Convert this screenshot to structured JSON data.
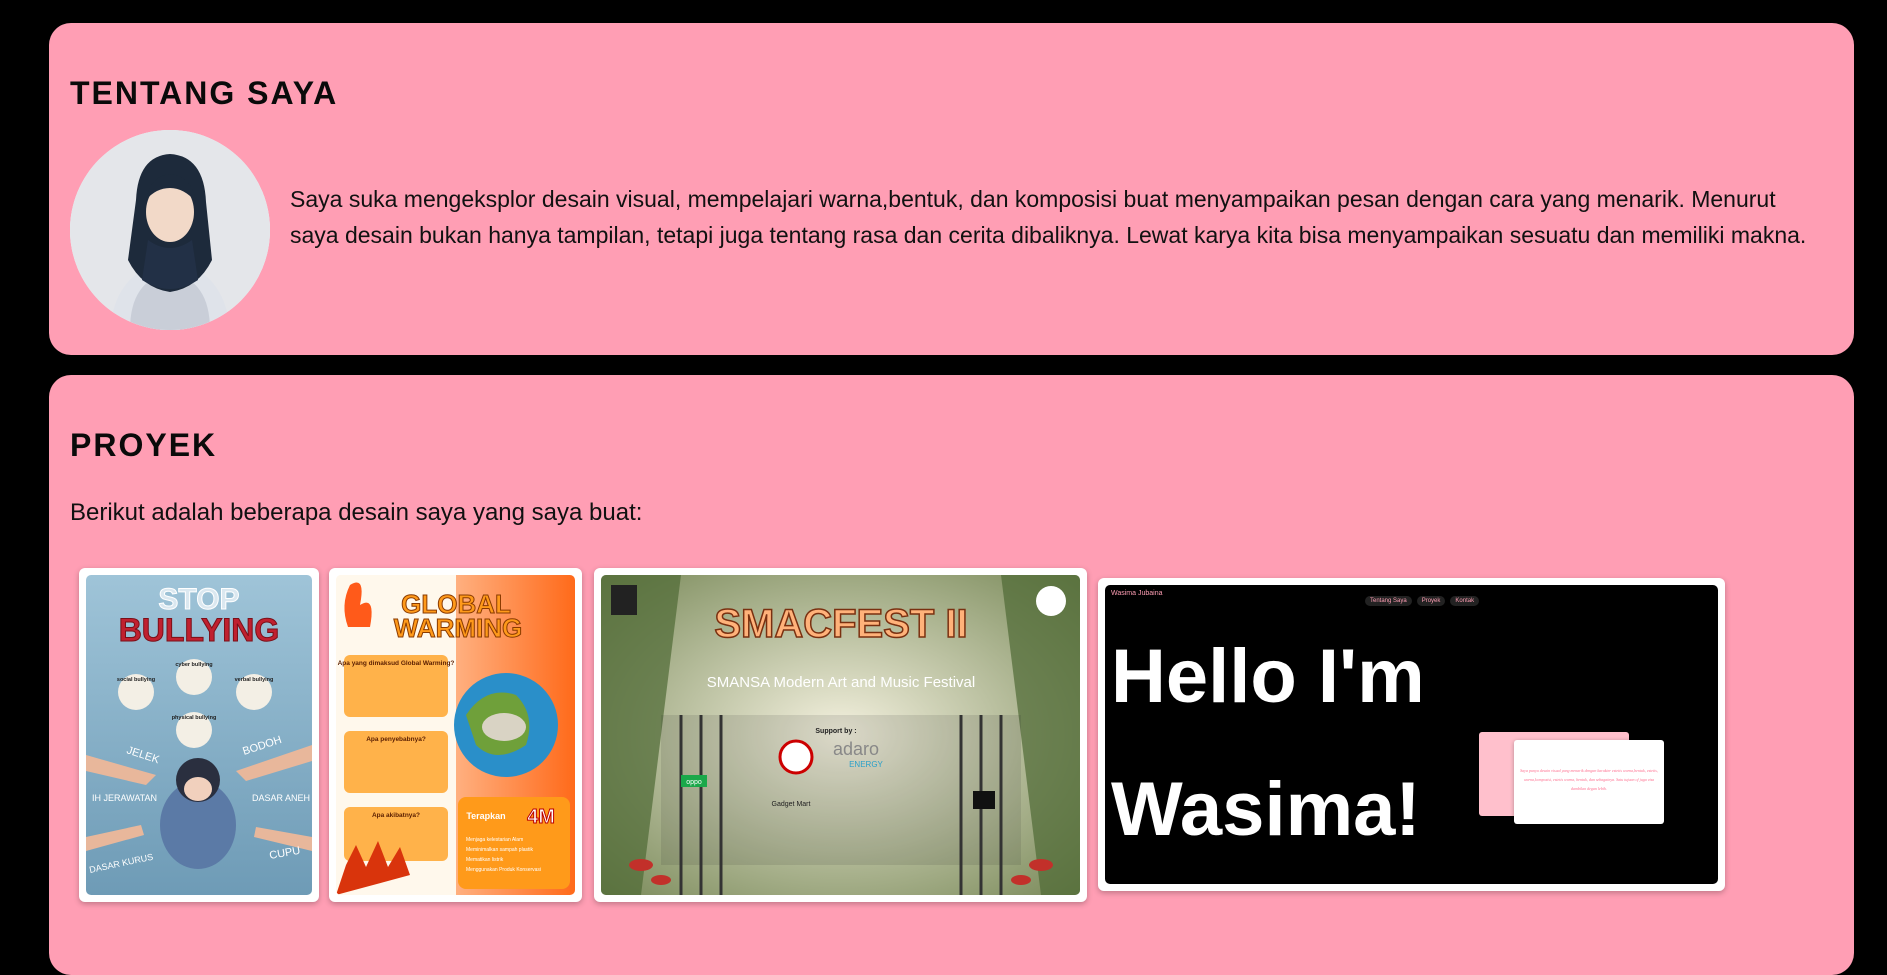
{
  "about": {
    "title": "TENTANG SAYA",
    "text": "Saya suka mengeksplor desain visual, mempelajari warna,bentuk, dan komposisi buat menyampaikan pesan dengan cara yang menarik. Menurut saya desain bukan hanya tampilan, tetapi juga tentang rasa dan cerita dibaliknya. Lewat karya kita bisa menyampaikan sesuatu dan memiliki makna."
  },
  "projects": {
    "title": "PROYEK",
    "intro": "Berikut adalah beberapa desain saya yang saya buat:",
    "items": [
      {
        "stop": "STOP",
        "main": "BULLYING",
        "labels": [
          "cyber bullying",
          "social bullying",
          "verbal bullying",
          "physical bullying"
        ],
        "words": [
          "JELEK",
          "BODOH",
          "IH JERAWATAN",
          "DASAR ANEH",
          "DASAR KURUS",
          "CUPU"
        ]
      },
      {
        "title1": "GLOBAL",
        "title2": "WARMING",
        "q1": "Apa yang dimaksud Global Warming?",
        "q2": "Apa penyebabnya?",
        "q3": "Apa akibatnya?",
        "box_label": "Terapkan",
        "box_big": "4M",
        "box_items": [
          "Menjaga kelestarian Alam",
          "Meminimalkan sampah plastik",
          "Mematikan listrik",
          "Menggunakan Produk Konservasi"
        ]
      },
      {
        "title": "SMACFEST II",
        "subtitle": "SMANSA Modern Art and Music Festival",
        "support": "Support by :",
        "sponsor": "adaro",
        "sponsor_sub": "ENERGY",
        "logos": [
          "oppo",
          "Gadget Mart"
        ]
      },
      {
        "site_title": "Wasima Jubaina",
        "nav": [
          "Tentang Saya",
          "Proyek",
          "Kontak"
        ],
        "hero_line1": "Hello I'm",
        "hero_line2": "Wasima!",
        "card_text": "Saya punya desain visual yang menarik dengan karakter estetis warna,bentuk, estetis, warna,komposisi, estetis warna, bentuk, dan sebagainya. Satu tujuan of juga visa dambilan degan lebih."
      }
    ]
  },
  "colors": {
    "page_bg": "#000000",
    "card_bg": "#ff9eb4",
    "accent": "#ff9eb4"
  }
}
